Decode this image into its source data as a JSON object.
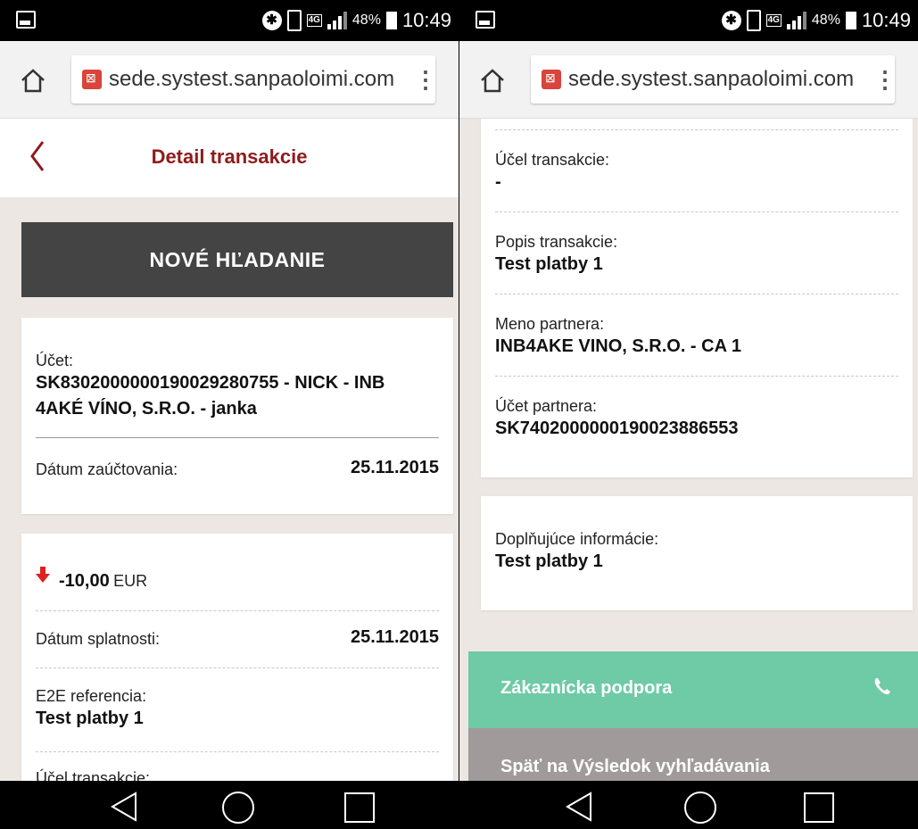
{
  "status_bar": {
    "battery_pct": "48%",
    "time": "10:49",
    "network": "4G"
  },
  "browser": {
    "url": "sede.systest.sanpaoloimi.com"
  },
  "left": {
    "header_title": "Detail transakcie",
    "new_search_label": "NOVÉ HĽADANIE",
    "account_label": "Účet:",
    "account_value_line1": "SK8302000000190029280755 - NICK - INB",
    "account_value_line2": "4AKÉ VÍNO, S.R.O. - janka",
    "posting_date_label": "Dátum zaúčtovania:",
    "posting_date_value": "25.11.2015",
    "amount_value": "-10,00",
    "amount_currency": "EUR",
    "due_date_label": "Dátum splatnosti:",
    "due_date_value": "25.11.2015",
    "e2e_label": "E2E referencia:",
    "e2e_value": "Test platby 1",
    "purpose_label_partial": "Účel transakcie:"
  },
  "right": {
    "purpose_label": "Účel transakcie:",
    "purpose_value": "-",
    "description_label": "Popis transakcie:",
    "description_value": "Test platby 1",
    "partner_name_label": "Meno partnera:",
    "partner_name_value": "INB4AKE VINO, S.R.O. - CA 1",
    "partner_account_label": "Účet partnera:",
    "partner_account_value": "SK7402000000190023886553",
    "additional_info_label": "Doplňujúce informácie:",
    "additional_info_value": "Test platby 1",
    "support_label": "Zákaznícka podpora",
    "back_to_results_label": "Späť na Výsledok vyhľadávania"
  },
  "colors": {
    "brand_red": "#8e1c1c",
    "support_green": "#6fcaa6",
    "button_dark": "#444444",
    "debit_arrow": "#e02020"
  },
  "icons": [
    "home-icon",
    "lock-icon",
    "menu-dots-icon",
    "back-chevron-icon",
    "down-arrow-icon",
    "phone-icon",
    "nav-back-icon",
    "nav-home-icon",
    "nav-recents-icon"
  ]
}
